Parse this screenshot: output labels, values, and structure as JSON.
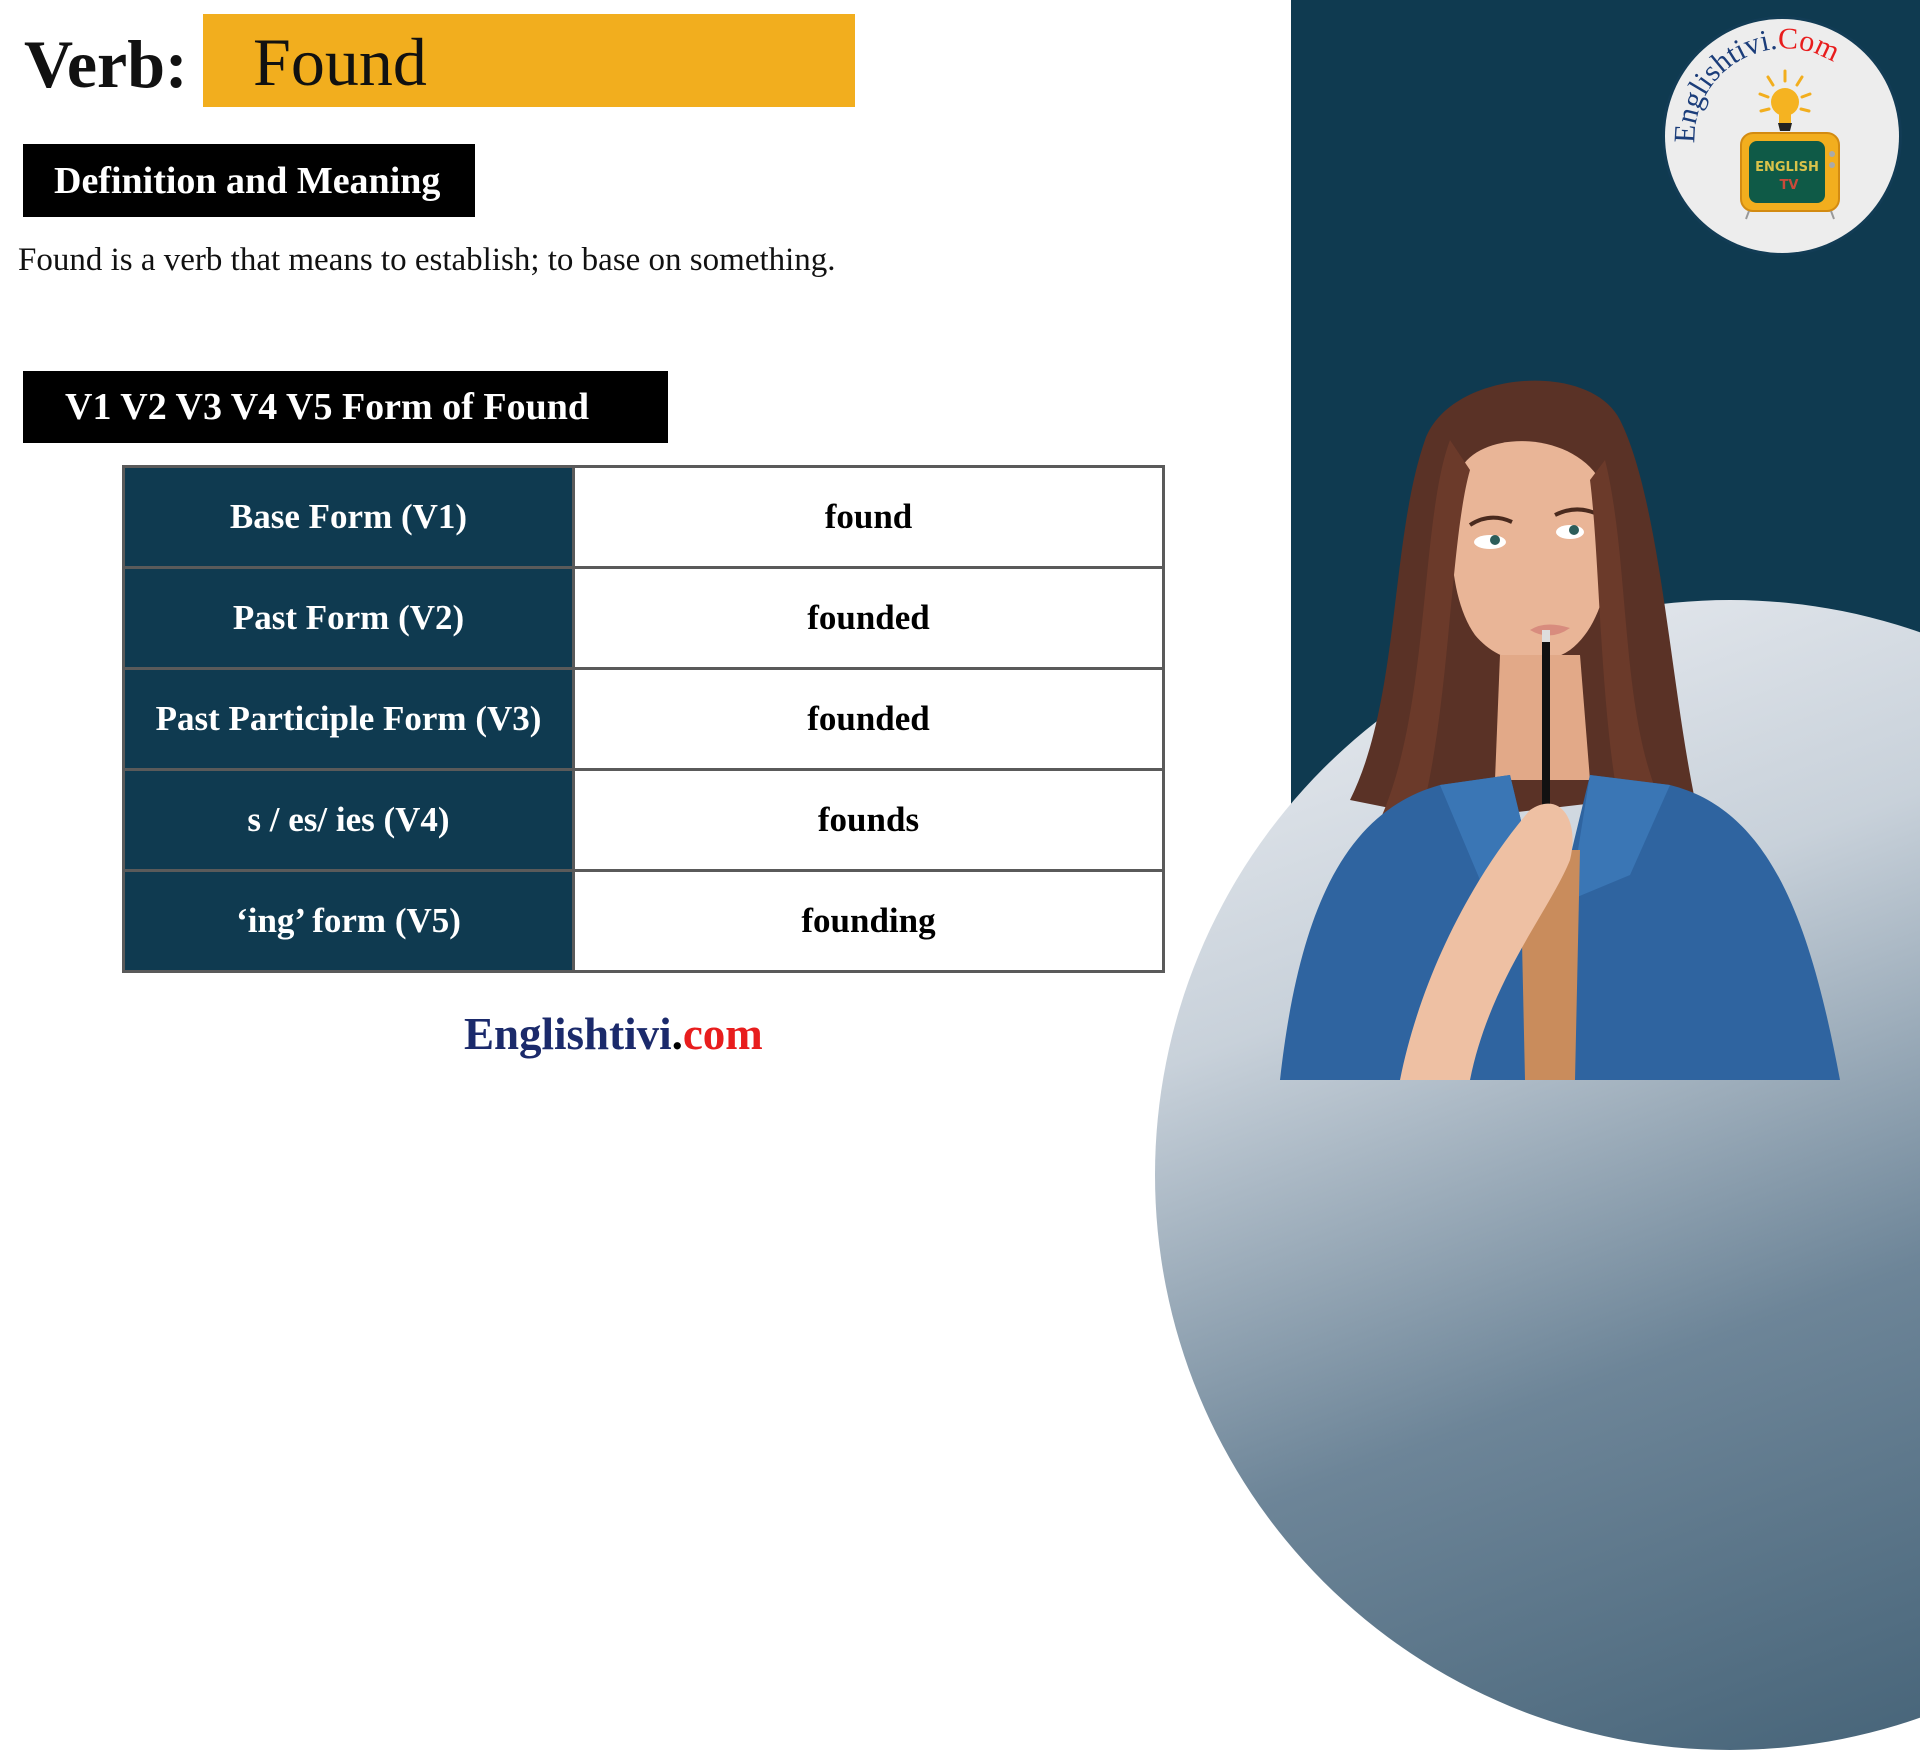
{
  "header": {
    "verb_label": "Verb:",
    "verb_word": "Found"
  },
  "definition": {
    "heading": "Definition and Meaning",
    "text": "Found is a verb that means to establish; to base on something."
  },
  "forms": {
    "heading": "V1 V2 V3 V4 V5 Form of Found",
    "rows": [
      {
        "label": "Base Form (V1)",
        "value": "found"
      },
      {
        "label": "Past Form (V2)",
        "value": "founded"
      },
      {
        "label": "Past Participle Form (V3)",
        "value": "founded"
      },
      {
        "label": "s / es/ ies (V4)",
        "value": "founds"
      },
      {
        "label": "‘ing’ form (V5)",
        "value": "founding"
      }
    ]
  },
  "footer": {
    "brand": "Englishtivi",
    "dot": ".",
    "tld": "com"
  },
  "logo": {
    "arc_text_main": "Englishtivi.",
    "arc_text_accent": "Com",
    "screen_line1": "ENGLISH",
    "screen_line2": "TV",
    "icons": [
      "light-bulb-icon",
      "tv-icon"
    ]
  },
  "colors": {
    "highlight": "#f2ae1e",
    "panel": "#0f3a50",
    "brand_navy": "#1b2a6b",
    "brand_red": "#e81d1d"
  }
}
